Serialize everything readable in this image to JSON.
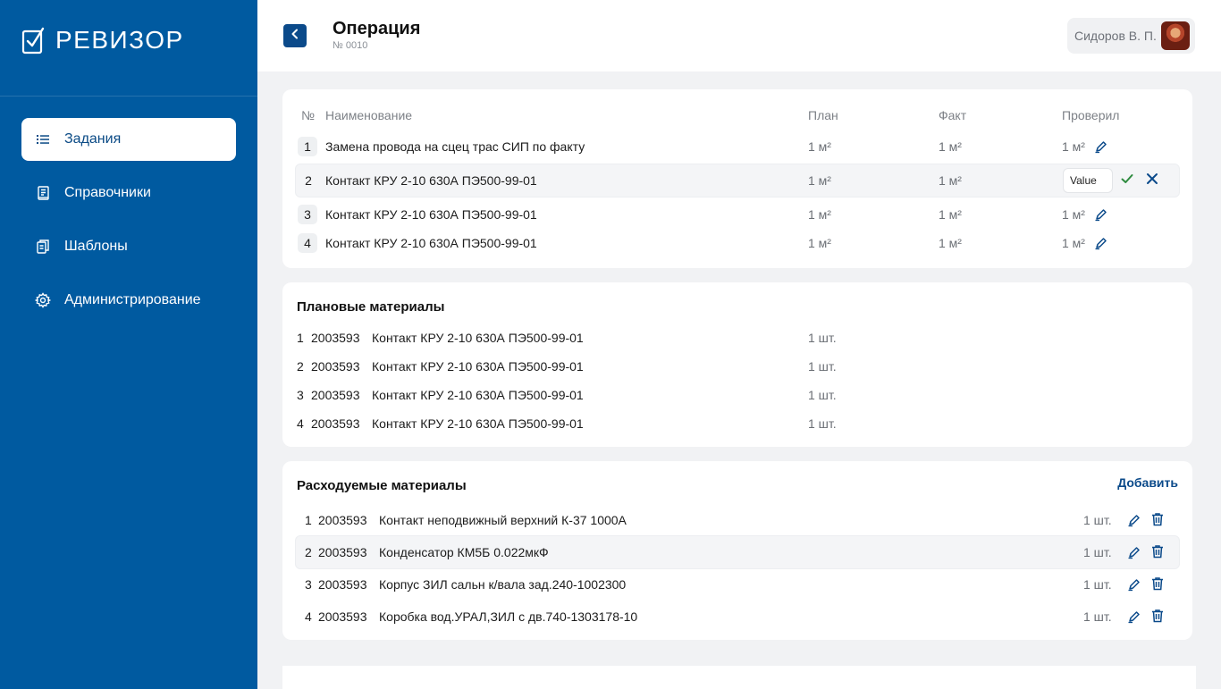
{
  "app": {
    "name": "РЕВИЗОР"
  },
  "sidebar": {
    "items": [
      {
        "label": "Задания",
        "icon": "list-icon",
        "active": true
      },
      {
        "label": "Справочники",
        "icon": "book-icon"
      },
      {
        "label": "Шаблоны",
        "icon": "copy-icon"
      },
      {
        "label": "Администрирование",
        "icon": "gear-icon"
      }
    ]
  },
  "header": {
    "title": "Операция",
    "subtitle": "№ 0010",
    "user": "Сидоров В. П."
  },
  "operations": {
    "columns": {
      "num": "№",
      "name": "Наименование",
      "plan": "План",
      "fact": "Факт",
      "checked": "Проверил"
    },
    "rows": [
      {
        "num": "1",
        "name": "Замена провода на сцец трас СИП по факту",
        "plan": "1 м²",
        "fact": "1 м²",
        "checked": "1 м²"
      },
      {
        "num": "2",
        "name": "Контакт КРУ 2-10 630А ПЭ500-99-01",
        "plan": "1 м²",
        "fact": "1 м²",
        "input_value": "Value"
      },
      {
        "num": "3",
        "name": "Контакт КРУ 2-10 630А ПЭ500-99-01",
        "plan": "1 м²",
        "fact": "1 м²",
        "checked": "1 м²"
      },
      {
        "num": "4",
        "name": "Контакт КРУ 2-10 630А ПЭ500-99-01",
        "plan": "1 м²",
        "fact": "1 м²",
        "checked": "1 м²"
      }
    ]
  },
  "planned": {
    "title": "Плановые материалы",
    "rows": [
      {
        "num": "1",
        "code": "2003593",
        "name": "Контакт КРУ 2-10 630А ПЭ500-99-01",
        "qty": "1 шт."
      },
      {
        "num": "2",
        "code": "2003593",
        "name": "Контакт КРУ 2-10 630А ПЭ500-99-01",
        "qty": "1 шт."
      },
      {
        "num": "3",
        "code": "2003593",
        "name": "Контакт КРУ 2-10 630А ПЭ500-99-01",
        "qty": "1 шт."
      },
      {
        "num": "4",
        "code": "2003593",
        "name": "Контакт КРУ 2-10 630А ПЭ500-99-01",
        "qty": "1 шт."
      }
    ]
  },
  "consumed": {
    "title": "Расходуемые материалы",
    "add_label": "Добавить",
    "rows": [
      {
        "num": "1",
        "code": "2003593",
        "name": "Контакт неподвижный верхний К-37 1000А",
        "qty": "1 шт."
      },
      {
        "num": "2",
        "code": "2003593",
        "name": "Конденсатор КМ5Б 0.022мкФ",
        "qty": "1 шт."
      },
      {
        "num": "3",
        "code": "2003593",
        "name": "Корпус ЗИЛ сальн к/вала зад.240-1002300",
        "qty": "1 шт."
      },
      {
        "num": "4",
        "code": "2003593",
        "name": "Коробка вод.УРАЛ,ЗИЛ с дв.740-1303178-10",
        "qty": "1 шт."
      }
    ]
  },
  "colors": {
    "primary": "#005aa0",
    "accent": "#0b4a8a",
    "confirm": "#2e8b3f"
  }
}
